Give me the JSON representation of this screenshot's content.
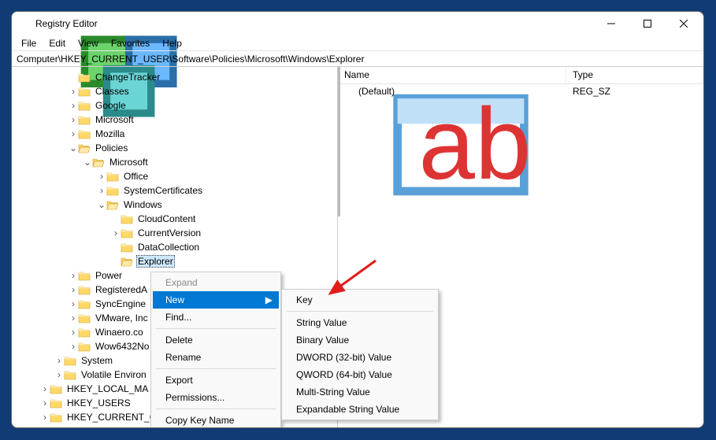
{
  "title": "Registry Editor",
  "menu": {
    "file": "File",
    "edit": "Edit",
    "view": "View",
    "fav": "Favorites",
    "help": "Help"
  },
  "address": "Computer\\HKEY_CURRENT_USER\\Software\\Policies\\Microsoft\\Windows\\Explorer",
  "tree": {
    "changetracker": "ChangeTracker",
    "classes": "Classes",
    "google": "Google",
    "microsoft": "Microsoft",
    "mozilla": "Mozilla",
    "policies": "Policies",
    "pol_microsoft": "Microsoft",
    "office": "Office",
    "syscert": "SystemCertificates",
    "windows": "Windows",
    "cloudcontent": "CloudContent",
    "currentversion": "CurrentVersion",
    "datacollection": "DataCollection",
    "explorer": "Explorer",
    "power": "Power",
    "registereda": "RegisteredA",
    "syncengine": "SyncEngine",
    "vmware": "VMware, Inc",
    "winaero": "Winaero.co",
    "wow6432": "Wow6432No",
    "system": "System",
    "volatile": "Volatile Environ",
    "hklm": "HKEY_LOCAL_MA",
    "hku": "HKEY_USERS",
    "hkcc": "HKEY_CURRENT_C"
  },
  "list": {
    "col_name": "Name",
    "col_type": "Type",
    "default_name": "(Default)",
    "default_type": "REG_SZ"
  },
  "ctx": {
    "expand": "Expand",
    "new": "New",
    "find": "Find...",
    "delete": "Delete",
    "rename": "Rename",
    "export": "Export",
    "perms": "Permissions...",
    "copyname": "Copy Key Name"
  },
  "sub": {
    "key": "Key",
    "string": "String Value",
    "binary": "Binary Value",
    "dword": "DWORD (32-bit) Value",
    "qword": "QWORD (64-bit) Value",
    "multi": "Multi-String Value",
    "expand": "Expandable String Value"
  }
}
